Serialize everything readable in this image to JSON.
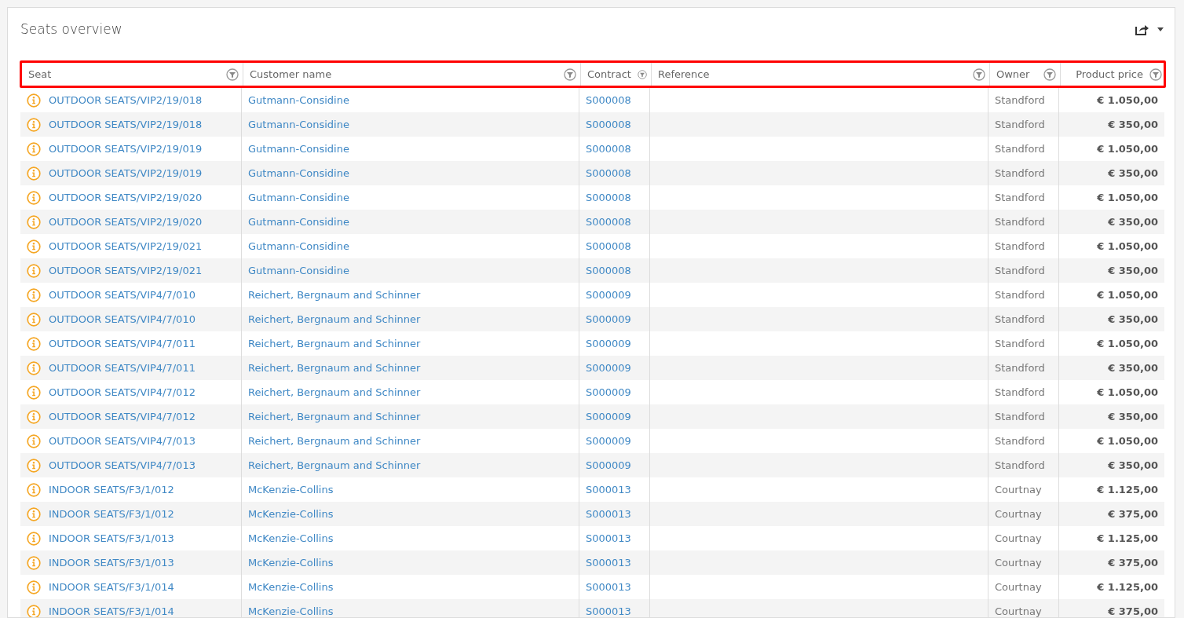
{
  "panel": {
    "title": "Seats overview"
  },
  "table": {
    "header_highlighted": true,
    "columns": [
      {
        "label": "Seat"
      },
      {
        "label": "Customer name"
      },
      {
        "label": "Contract"
      },
      {
        "label": "Reference"
      },
      {
        "label": "Owner"
      },
      {
        "label": "Product price"
      }
    ],
    "rows": [
      {
        "seat": "OUTDOOR SEATS/VIP2/19/018",
        "customer": "Gutmann-Considine",
        "contract": "S000008",
        "owner": "Standford",
        "price": "€ 1.050,00"
      },
      {
        "seat": "OUTDOOR SEATS/VIP2/19/018",
        "customer": "Gutmann-Considine",
        "contract": "S000008",
        "owner": "Standford",
        "price": "€ 350,00"
      },
      {
        "seat": "OUTDOOR SEATS/VIP2/19/019",
        "customer": "Gutmann-Considine",
        "contract": "S000008",
        "owner": "Standford",
        "price": "€ 1.050,00"
      },
      {
        "seat": "OUTDOOR SEATS/VIP2/19/019",
        "customer": "Gutmann-Considine",
        "contract": "S000008",
        "owner": "Standford",
        "price": "€ 350,00"
      },
      {
        "seat": "OUTDOOR SEATS/VIP2/19/020",
        "customer": "Gutmann-Considine",
        "contract": "S000008",
        "owner": "Standford",
        "price": "€ 1.050,00"
      },
      {
        "seat": "OUTDOOR SEATS/VIP2/19/020",
        "customer": "Gutmann-Considine",
        "contract": "S000008",
        "owner": "Standford",
        "price": "€ 350,00"
      },
      {
        "seat": "OUTDOOR SEATS/VIP2/19/021",
        "customer": "Gutmann-Considine",
        "contract": "S000008",
        "owner": "Standford",
        "price": "€ 1.050,00"
      },
      {
        "seat": "OUTDOOR SEATS/VIP2/19/021",
        "customer": "Gutmann-Considine",
        "contract": "S000008",
        "owner": "Standford",
        "price": "€ 350,00"
      },
      {
        "seat": "OUTDOOR SEATS/VIP4/7/010",
        "customer": "Reichert, Bergnaum and Schinner",
        "contract": "S000009",
        "owner": "Standford",
        "price": "€ 1.050,00"
      },
      {
        "seat": "OUTDOOR SEATS/VIP4/7/010",
        "customer": "Reichert, Bergnaum and Schinner",
        "contract": "S000009",
        "owner": "Standford",
        "price": "€ 350,00"
      },
      {
        "seat": "OUTDOOR SEATS/VIP4/7/011",
        "customer": "Reichert, Bergnaum and Schinner",
        "contract": "S000009",
        "owner": "Standford",
        "price": "€ 1.050,00"
      },
      {
        "seat": "OUTDOOR SEATS/VIP4/7/011",
        "customer": "Reichert, Bergnaum and Schinner",
        "contract": "S000009",
        "owner": "Standford",
        "price": "€ 350,00"
      },
      {
        "seat": "OUTDOOR SEATS/VIP4/7/012",
        "customer": "Reichert, Bergnaum and Schinner",
        "contract": "S000009",
        "owner": "Standford",
        "price": "€ 1.050,00"
      },
      {
        "seat": "OUTDOOR SEATS/VIP4/7/012",
        "customer": "Reichert, Bergnaum and Schinner",
        "contract": "S000009",
        "owner": "Standford",
        "price": "€ 350,00"
      },
      {
        "seat": "OUTDOOR SEATS/VIP4/7/013",
        "customer": "Reichert, Bergnaum and Schinner",
        "contract": "S000009",
        "owner": "Standford",
        "price": "€ 1.050,00"
      },
      {
        "seat": "OUTDOOR SEATS/VIP4/7/013",
        "customer": "Reichert, Bergnaum and Schinner",
        "contract": "S000009",
        "owner": "Standford",
        "price": "€ 350,00"
      },
      {
        "seat": "INDOOR SEATS/F3/1/012",
        "customer": "McKenzie-Collins",
        "contract": "S000013",
        "owner": "Courtnay",
        "price": "€ 1.125,00"
      },
      {
        "seat": "INDOOR SEATS/F3/1/012",
        "customer": "McKenzie-Collins",
        "contract": "S000013",
        "owner": "Courtnay",
        "price": "€ 375,00"
      },
      {
        "seat": "INDOOR SEATS/F3/1/013",
        "customer": "McKenzie-Collins",
        "contract": "S000013",
        "owner": "Courtnay",
        "price": "€ 1.125,00"
      },
      {
        "seat": "INDOOR SEATS/F3/1/013",
        "customer": "McKenzie-Collins",
        "contract": "S000013",
        "owner": "Courtnay",
        "price": "€ 375,00"
      },
      {
        "seat": "INDOOR SEATS/F3/1/014",
        "customer": "McKenzie-Collins",
        "contract": "S000013",
        "owner": "Courtnay",
        "price": "€ 1.125,00"
      },
      {
        "seat": "INDOOR SEATS/F3/1/014",
        "customer": "McKenzie-Collins",
        "contract": "S000013",
        "owner": "Courtnay",
        "price": "€ 375,00"
      }
    ]
  }
}
